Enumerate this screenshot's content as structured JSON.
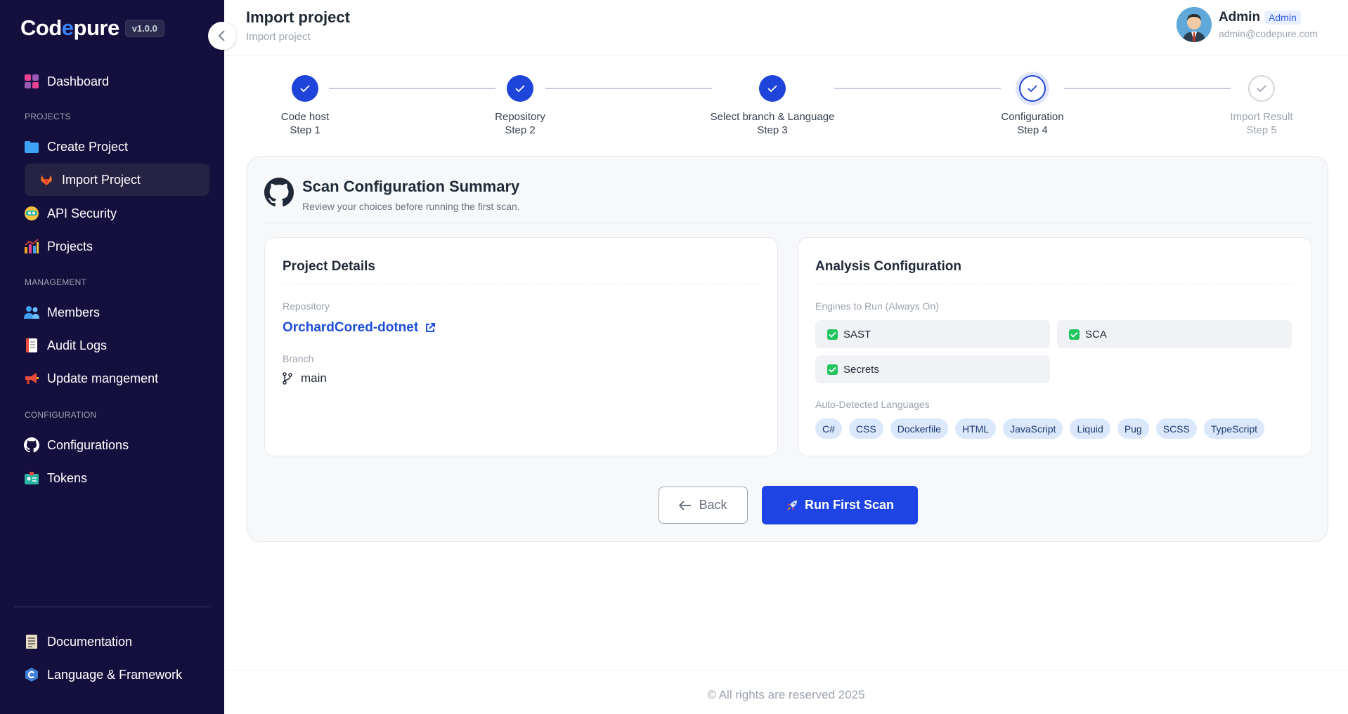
{
  "app": {
    "logo_pre": "Cod",
    "logo_accent": "e",
    "logo_post": "pure",
    "version": "v1.0.0"
  },
  "sidebar": {
    "dashboard": "Dashboard",
    "section_projects": "PROJECTS",
    "create_project": "Create Project",
    "import_project": "Import Project",
    "api_security": "API Security",
    "projects": "Projects",
    "section_management": "MANAGEMENT",
    "members": "Members",
    "audit_logs": "Audit Logs",
    "update_management": "Update mangement",
    "section_configuration": "CONFIGURATION",
    "configurations": "Configurations",
    "tokens": "Tokens",
    "documentation": "Documentation",
    "language_framework": "Language & Framework"
  },
  "header": {
    "title": "Import project",
    "breadcrumb": "Import project",
    "user_name": "Admin",
    "user_role": "Admin",
    "user_email": "admin@codepure.com"
  },
  "stepper": {
    "steps": [
      {
        "name": "Code host",
        "step": "Step 1",
        "status": "done"
      },
      {
        "name": "Repository",
        "step": "Step 2",
        "status": "done"
      },
      {
        "name": "Select branch & Language",
        "step": "Step 3",
        "status": "done"
      },
      {
        "name": "Configuration",
        "step": "Step 4",
        "status": "current"
      },
      {
        "name": "Import Result",
        "step": "Step 5",
        "status": "pending"
      }
    ]
  },
  "summary": {
    "title": "Scan Configuration Summary",
    "subtitle": "Review your choices before running the first scan.",
    "project_details": {
      "title": "Project Details",
      "repo_label": "Repository",
      "repo_name": "OrchardCored-dotnet",
      "branch_label": "Branch",
      "branch_name": "main"
    },
    "analysis": {
      "title": "Analysis Configuration",
      "engines_label": "Engines to Run (Always On)",
      "engines": [
        "SAST",
        "SCA",
        "Secrets"
      ],
      "languages_label": "Auto-Detected Languages",
      "languages": [
        "C#",
        "CSS",
        "Dockerfile",
        "HTML",
        "JavaScript",
        "Liquid",
        "Pug",
        "SCSS",
        "TypeScript"
      ]
    },
    "back_label": "Back",
    "run_label": "Run First Scan"
  },
  "footer": {
    "text": "© All rights are reserved 2025"
  },
  "colors": {
    "sidebar_bg": "#140f3d",
    "primary": "#1f44e6",
    "success": "#22c55e"
  }
}
